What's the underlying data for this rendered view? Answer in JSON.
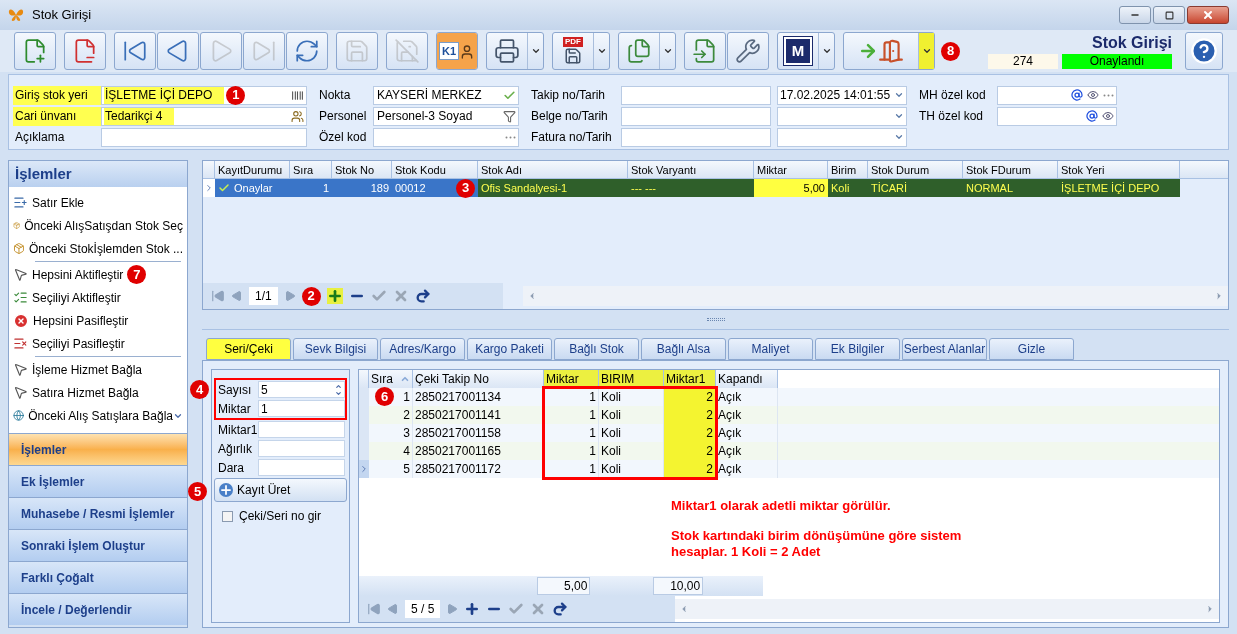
{
  "window": {
    "title": "Stok Girişi"
  },
  "toolbar": {
    "groups": [
      [
        {
          "kind": "new",
          "disabled": false,
          "active": false,
          "dropdown": false
        }
      ],
      [
        {
          "kind": "delete",
          "disabled": false,
          "active": false,
          "dropdown": false
        }
      ],
      [
        {
          "kind": "first",
          "disabled": false,
          "active": false,
          "dropdown": false
        },
        {
          "kind": "prev",
          "disabled": false,
          "active": false,
          "dropdown": false
        },
        {
          "kind": "next",
          "disabled": true,
          "active": false,
          "dropdown": false
        },
        {
          "kind": "last",
          "disabled": true,
          "active": false,
          "dropdown": false
        },
        {
          "kind": "refresh",
          "disabled": false,
          "active": false,
          "dropdown": false
        }
      ],
      [
        {
          "kind": "save",
          "disabled": true,
          "active": false,
          "dropdown": false
        }
      ],
      [
        {
          "kind": "cancel",
          "disabled": true,
          "active": false,
          "dropdown": false
        }
      ],
      [
        {
          "kind": "card",
          "label": "K1",
          "disabled": false,
          "active": true,
          "dropdown": false
        }
      ],
      [
        {
          "kind": "print",
          "disabled": false,
          "active": false,
          "dropdown": true
        }
      ],
      [
        {
          "kind": "pdf",
          "label": "PDF",
          "disabled": false,
          "active": false,
          "dropdown": true
        }
      ],
      [
        {
          "kind": "export",
          "disabled": false,
          "active": false,
          "dropdown": true
        }
      ],
      [
        {
          "kind": "import",
          "disabled": false,
          "active": false,
          "dropdown": false
        },
        {
          "kind": "settings",
          "disabled": false,
          "active": false,
          "dropdown": false
        }
      ],
      [
        {
          "kind": "m",
          "label": "M",
          "disabled": false,
          "active": false,
          "dropdown": true
        }
      ],
      [
        {
          "kind": "exit",
          "disabled": false,
          "active": false,
          "dropdown": true,
          "highlighted": true,
          "callout": "8"
        }
      ]
    ],
    "form_title": "Stok Girişi",
    "record_no": "274",
    "status": "Onaylandı"
  },
  "header": {
    "columns": [
      [
        {
          "label": "Giriş stok yeri",
          "value": "İŞLETME İÇİ DEPO",
          "highlighted": true,
          "callout": "1",
          "kind": "barcode"
        },
        {
          "label": "Cari ünvanı",
          "value": "Tedarikçi 4",
          "highlighted": true,
          "kind": "people"
        },
        {
          "label": "Açıklama",
          "highlighted": false
        }
      ],
      [
        {
          "label": "Nokta",
          "value": "KAYSERİ MERKEZ",
          "highlighted": false,
          "kind": "check"
        },
        {
          "label": "Personel",
          "value": "Personel-3 Soyad",
          "highlighted": false,
          "kind": "filter"
        },
        {
          "label": "Özel kod",
          "highlighted": false,
          "kind": "dots"
        }
      ],
      [
        {
          "label": "Takip no/Tarih",
          "date": "17.02.2025 14:01:55",
          "highlighted": false
        },
        {
          "label": "Belge no/Tarih",
          "highlighted": false
        },
        {
          "label": "Fatura no/Tarih",
          "highlighted": false
        }
      ],
      [
        {
          "label": "MH özel kod",
          "highlighted": false,
          "kind": "email-more"
        },
        {
          "label": "TH özel kod",
          "highlighted": false,
          "kind": "email"
        }
      ]
    ]
  },
  "sidebar": {
    "title": "İşlemler",
    "groups": [
      [
        {
          "label": "Satır Ekle",
          "kind": "add-row",
          "menu": false
        },
        {
          "label": "Önceki AlışSatışdan Stok Seç",
          "kind": "package",
          "menu": false
        },
        {
          "label": "Önceki Stokİşlemden Stok ...",
          "kind": "package",
          "menu": false
        }
      ],
      [
        {
          "label": "Hepsini Aktifleştir",
          "kind": "pointer",
          "menu": false,
          "callout": "7"
        },
        {
          "label": "Seçiliyi Aktifleştir",
          "kind": "checklist",
          "menu": false
        },
        {
          "label": "Hepsini Pasifleştir",
          "kind": "red-x",
          "menu": false
        },
        {
          "label": "Seçiliyi Pasifleştir",
          "kind": "list-x",
          "menu": false
        }
      ],
      [
        {
          "label": "İşleme Hizmet Bağla",
          "kind": "pointer",
          "menu": false
        },
        {
          "label": "Satıra Hizmet Bağla",
          "kind": "pointer",
          "menu": false
        },
        {
          "label": "Önceki Alış Satışlara Bağla",
          "kind": "globe",
          "menu": true
        }
      ]
    ],
    "sections": [
      {
        "label": "İşlemler",
        "selected": true
      },
      {
        "label": "Ek İşlemler",
        "selected": false
      },
      {
        "label": "Muhasebe / Resmi İşlemler",
        "selected": false
      },
      {
        "label": "Sonraki İşlem Oluştur",
        "selected": false
      },
      {
        "label": "Farklı Çoğalt",
        "selected": false
      },
      {
        "label": "İncele / Değerlendir",
        "selected": false
      }
    ]
  },
  "main_grid": {
    "columns": [
      "KayıtDurumu",
      "Sıra",
      "Stok No",
      "Stok Kodu",
      "Stok Adı",
      "Stok Varyantı",
      "Miktar",
      "Birim",
      "Stok Durum",
      "Stok FDurum",
      "Stok Yeri"
    ],
    "rows": [
      {
        "selected": true,
        "cells": [
          {
            "text": "Onaylar",
            "kind": "status"
          },
          {
            "text": "1",
            "kind": "focus"
          },
          {
            "text": "189",
            "kind": "focus"
          },
          {
            "text": "00012",
            "kind": "focus"
          },
          {
            "text": "Ofis Sandalyesi-1",
            "kind": "data",
            "callout": "3"
          },
          {
            "text": "--- ---",
            "kind": "data"
          },
          {
            "text": "5,00",
            "kind": "edit"
          },
          {
            "text": "Koli",
            "kind": "data"
          },
          {
            "text": "TİCARİ",
            "kind": "data"
          },
          {
            "text": "NORMAL",
            "kind": "data"
          },
          {
            "text": "İŞLETME İÇİ DEPO",
            "kind": "data"
          }
        ]
      }
    ],
    "pager": {
      "text": "1/1",
      "callout": "2"
    }
  },
  "tabs": [
    {
      "label": "Seri/Çeki",
      "selected": true
    },
    {
      "label": "Sevk Bilgisi",
      "selected": false
    },
    {
      "label": "Adres/Kargo",
      "selected": false
    },
    {
      "label": "Kargo Paketi",
      "selected": false
    },
    {
      "label": "Bağlı Stok",
      "selected": false
    },
    {
      "label": "Bağlı Alsa",
      "selected": false
    },
    {
      "label": "Maliyet",
      "selected": false
    },
    {
      "label": "Ek Bilgiler",
      "selected": false
    },
    {
      "label": "Serbest Alanlar",
      "selected": false
    },
    {
      "label": "Gizle",
      "selected": false
    }
  ],
  "serial_form": {
    "callout": "4",
    "framed_fields": [
      {
        "label": "Sayısı",
        "value": "5",
        "kind": "spinner"
      },
      {
        "label": "Miktar",
        "value": "1",
        "kind": "text"
      }
    ],
    "fields": [
      {
        "label": "Miktar1"
      },
      {
        "label": "Ağırlık"
      },
      {
        "label": "Dara"
      }
    ],
    "button": {
      "label": "Kayıt Üret",
      "callout": "5"
    },
    "checkbox": {
      "label": "Çeki/Seri no gir",
      "checked": false
    }
  },
  "serial_grid": {
    "callout": "6",
    "columns": [
      {
        "label": "Sıra",
        "header_highlighted": false,
        "cells_highlighted": false,
        "sorted": true
      },
      {
        "label": "Çeki Takip No",
        "header_highlighted": false,
        "cells_highlighted": false,
        "sorted": false
      },
      {
        "label": "Miktar",
        "header_highlighted": true,
        "cells_highlighted": false,
        "sorted": false,
        "total": "5,00"
      },
      {
        "label": "BIRIM",
        "header_highlighted": true,
        "cells_highlighted": false,
        "sorted": false
      },
      {
        "label": "Miktar1",
        "header_highlighted": true,
        "cells_highlighted": true,
        "sorted": false,
        "total": "10,00"
      },
      {
        "label": "Kapandı",
        "header_highlighted": false,
        "cells_highlighted": false,
        "sorted": false
      }
    ],
    "rows": [
      {
        "current": false,
        "cells": [
          "1",
          "2850217001134",
          "1",
          "Koli",
          "2",
          "Açık"
        ]
      },
      {
        "current": false,
        "cells": [
          "2",
          "2850217001141",
          "1",
          "Koli",
          "2",
          "Açık"
        ]
      },
      {
        "current": false,
        "cells": [
          "3",
          "2850217001158",
          "1",
          "Koli",
          "2",
          "Açık"
        ]
      },
      {
        "current": false,
        "cells": [
          "4",
          "2850217001165",
          "1",
          "Koli",
          "2",
          "Açık"
        ]
      },
      {
        "current": true,
        "cells": [
          "5",
          "2850217001172",
          "1",
          "Koli",
          "2",
          "Açık"
        ]
      }
    ],
    "pager": {
      "text": "5 / 5"
    }
  },
  "notes": [
    "Miktar1 olarak adetli miktar görülür.",
    "Stok kartındaki birim dönüşümüne göre sistem hesaplar. 1 Koli = 2 Adet"
  ]
}
